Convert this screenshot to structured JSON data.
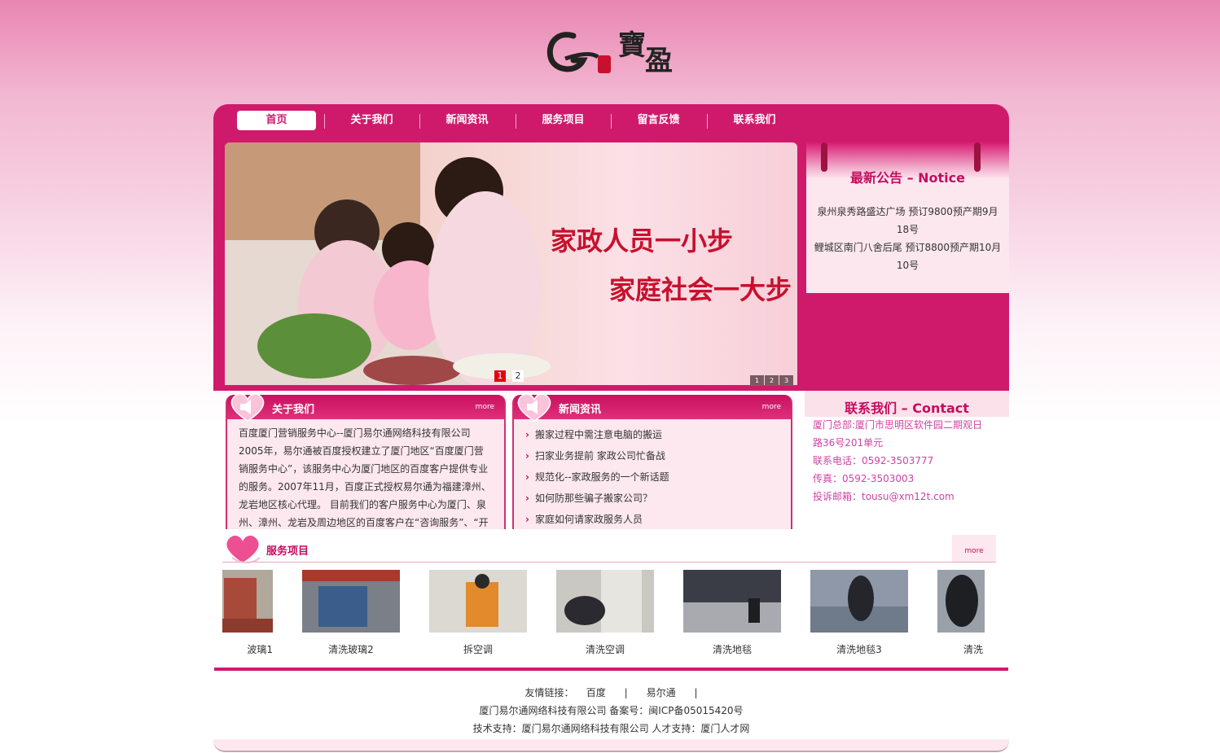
{
  "logo": {
    "text": "G寶盈",
    "icon": "brand-logo"
  },
  "nav": [
    {
      "label": "首页",
      "active": true
    },
    {
      "label": "关于我们"
    },
    {
      "label": "新闻资讯"
    },
    {
      "label": "服务项目"
    },
    {
      "label": "留言反馈"
    },
    {
      "label": "联系我们"
    }
  ],
  "banner": {
    "line1": "家政人员一小步",
    "line2": "家庭社会一大步",
    "dots": [
      "1",
      "2"
    ],
    "mini_thumbs": [
      "1",
      "2",
      "3"
    ]
  },
  "notice": {
    "title": "最新公告 – Notice",
    "items": [
      "泉州泉秀路盛达广场 预订9800预产期9月18号",
      "鲤城区南门八舍后尾 预订8800预产期10月10号"
    ]
  },
  "about": {
    "title": "关于我们",
    "more": "more",
    "text": "百度厦门营销服务中心--厦门易尔通网络科技有限公司2005年，易尔通被百度授权建立了厦门地区“百度厦门营销服务中心”，该服务中心为厦门地区的百度客户提供专业的服务。2007年11月，百度正式授权易尔通为福建漳州、龙岩地区核心代理。 目前我们的客户服务中心为厦门、泉州、漳州、龙岩及周边地区的百度客户在“咨询服务”、“开户"
  },
  "news": {
    "title": "新闻资讯",
    "more": "more",
    "items": [
      "搬家过程中需注意电脑的搬运",
      "扫家业务提前 家政公司忙备战",
      "规范化--家政服务的一个新话题",
      "如何防那些骗子搬家公司？",
      "家庭如何请家政服务人员"
    ]
  },
  "contact": {
    "title": "联系我们 – Contact",
    "lines": [
      "厦门总部:厦门市思明区软件园二期观日",
      "路36号201单元",
      "联系电话：0592-3503777",
      "传真：0592-3503003",
      "投诉邮箱：tousu@xm12t.com"
    ]
  },
  "services": {
    "title": "服务项目",
    "more": "more",
    "items": [
      {
        "caption": "波璃1",
        "colors": [
          "#b0a89a",
          "#a84a3a"
        ]
      },
      {
        "caption": "清洗玻璃2",
        "colors": [
          "#7a7f88",
          "#3b5d8c"
        ]
      },
      {
        "caption": "拆空调",
        "colors": [
          "#dcd9d2",
          "#e28a2c"
        ]
      },
      {
        "caption": "清洗空调",
        "colors": [
          "#c9c8c3",
          "#2b2a30"
        ]
      },
      {
        "caption": "清洗地毯",
        "colors": [
          "#3a3d45",
          "#a8aab0"
        ]
      },
      {
        "caption": "清洗地毯3",
        "colors": [
          "#8e98a8",
          "#24262c"
        ]
      },
      {
        "caption": "清洗",
        "colors": [
          "#9aa0a8",
          "#1e1f22"
        ]
      }
    ]
  },
  "footer": {
    "links_label": "友情链接：",
    "links": [
      "百度",
      "易尔通"
    ],
    "sep": "|",
    "line2": "厦门易尔通网络科技有限公司 备案号：闽ICP备05015420号",
    "line3": "技术支持：厦门易尔通网络科技有限公司 人才支持：厦门人才网"
  },
  "colors": {
    "brand": "#cf1a6c",
    "contact_text": "#d043a3",
    "notice_title": "#c30d5f"
  }
}
